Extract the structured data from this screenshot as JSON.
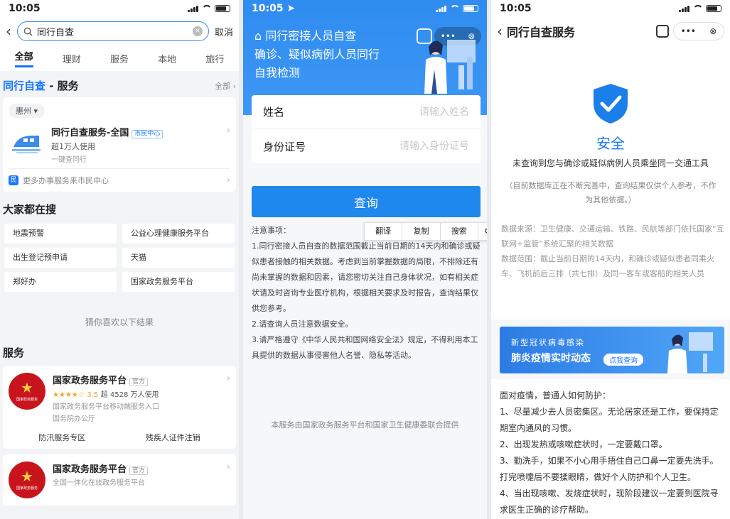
{
  "status_time": "10:05",
  "panel1": {
    "search_value": "同行自查",
    "cancel": "取消",
    "tabs": [
      "全部",
      "理财",
      "服务",
      "本地",
      "旅行"
    ],
    "section_title_hl": "同行自查",
    "section_title_rest": " - 服务",
    "all_label": "全部",
    "city": "惠州",
    "service": {
      "name": "同行自查服务-全国",
      "badge": "市民中心",
      "users": "超1万人使用",
      "desc": "一键查同行",
      "more": "更多办事服务来市民中心"
    },
    "hot_title": "大家都在搜",
    "hot_items": [
      "地震预警",
      "公益心理健康服务平台",
      "出生登记预申请",
      "天猫",
      "郑好办",
      "国家政务服务平台"
    ],
    "guess": "猜你喜欢以下结果",
    "svc_title": "服务",
    "gov1": {
      "name": "国家政务服务平台",
      "badge": "官方",
      "stars": "★★★★☆",
      "rating": "3.5",
      "users": "超 4528 万人使用",
      "desc": "国家政务服务平台移动端服务入口",
      "org": "国务院办公厅",
      "links": [
        "防汛服务专区",
        "残疾人证件注销"
      ]
    },
    "gov2": {
      "name": "国家政务服务平台",
      "badge": "官方",
      "desc": "全国一体化在线政务服务平台"
    },
    "emblem_text": "国家政务服务"
  },
  "panel2": {
    "title_line1": "同行密接人员自查",
    "title_line2": "确诊、疑似病例人员同行",
    "title_line3": "自我检测",
    "name_label": "姓名",
    "name_placeholder": "请输入姓名",
    "id_label": "身份证号",
    "id_placeholder": "请输入身份证号",
    "query_button": "查询",
    "context_menu": [
      "翻译",
      "复制",
      "搜索"
    ],
    "notes_title": "注意事项：",
    "notes": [
      "1.同行密接人员自查的数据范围截止当前日期的14天内和确诊或疑似患者接触的相关数据。考虑到当前掌握数据的局限，不排除还有尚未掌握的数据和因素，请您密切关注自己身体状况，如有相关症状请及时咨询专业医疗机构，根据相关要求及时报告，查询结果仅供您参考。",
      "2.请查询人员注意数据安全。",
      "3.请严格遵守《中华人民共和国网络安全法》规定，不得利用本工具提供的数据从事侵害他人名誉、隐私等活动。"
    ],
    "footer": "本服务由国家政务服务平台和国家卫生健康委联合提供"
  },
  "panel3": {
    "title": "同行自查服务",
    "safe": "安全",
    "result_line": "未查询到您与确诊或疑似病例人员乘坐同一交通工具",
    "result_note": "（目前数据库正在不断完善中，查询结果仅供个人参考，不作为其他依据。）",
    "source": "数据来源：卫生健康、交通运输、铁路、民航等部门依托国家“互联网+监管”系统汇聚的相关数据",
    "range": "数据范围：截止当前日期的14天内，和确诊或疑似患者同乘火车、飞机前后三排（共七排）及同一客车或客船的相关人员",
    "banner_l1": "新型冠状病毒感染",
    "banner_l2": "肺炎疫情实时动态",
    "banner_btn": "点我查询",
    "prevention_title": "面对疫情，普通人如何防护：",
    "prevention": [
      "1、尽量减少去人员密集区。无论居家还是工作，要保持定期室内通风的习惯。",
      "2、出现发热或咳嗽症状时，一定要戴口罩。",
      "3、勤洗手，如果不小心用手捂住自己口鼻一定要先洗手。打完喷嚏后不要揉眼睛，做好个人防护和个人卫生。",
      "4、当出现咳嗽、发烧症状时，现阶段建议一定要到医院寻求医生正确的诊疗帮助。"
    ]
  },
  "colors": {
    "accent": "#1677ff",
    "hero": "#2f8cf0",
    "emblem": "#c8151d"
  }
}
